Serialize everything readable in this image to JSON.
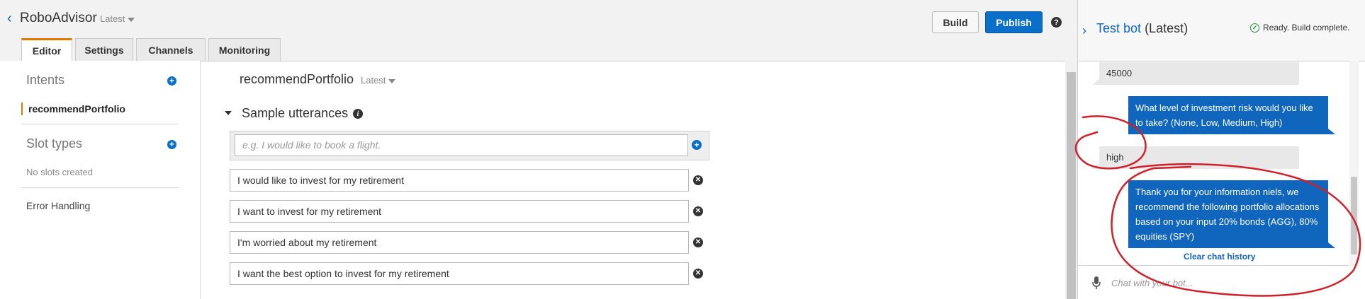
{
  "header": {
    "bot_name": "RoboAdvisor",
    "version": "Latest",
    "tabs": [
      "Editor",
      "Settings",
      "Channels",
      "Monitoring"
    ],
    "build_label": "Build",
    "publish_label": "Publish",
    "help_glyph": "?"
  },
  "sidebar": {
    "intents_heading": "Intents",
    "intent_item": "recommendPortfolio",
    "slot_types_heading": "Slot types",
    "no_slots": "No slots created",
    "error_handling": "Error Handling"
  },
  "editor": {
    "intent_name": "recommendPortfolio",
    "intent_version": "Latest",
    "utterances_heading": "Sample utterances",
    "utterance_placeholder": "e.g. I would like to book a flight.",
    "utterances": [
      "I would like to invest for my retirement",
      "I want to invest for my retirement",
      "I'm worried about my retirement",
      "I want the best option to invest for my retirement"
    ]
  },
  "test_bot": {
    "title": "Test bot",
    "version": "(Latest)",
    "status": "Ready. Build complete.",
    "messages": [
      {
        "from": "user",
        "text": "45000"
      },
      {
        "from": "bot",
        "text": "What level of investment risk would you like to take? (None, Low, Medium, High)"
      },
      {
        "from": "user",
        "text": "high"
      },
      {
        "from": "bot",
        "text": "Thank you for your information niels, we recommend the following portfolio allocations based on your input 20% bonds (AGG), 80% equities (SPY)"
      }
    ],
    "clear_history": "Clear chat history",
    "chat_placeholder": "Chat with your bot..."
  },
  "icons": {
    "back": "chevron-left-icon",
    "help": "question-circle-icon",
    "add": "plus-circle-icon",
    "remove": "x-circle-icon",
    "info": "info-circle-icon",
    "status": "check-circle-icon",
    "mic": "microphone-icon"
  },
  "colors": {
    "accent_blue": "#0a6fc9",
    "active_tab": "#e07b00",
    "bot_bubble": "#1066bd",
    "user_bubble": "#e8e8e8",
    "annotation": "#d0202a",
    "status_green": "#1f8f3a"
  }
}
